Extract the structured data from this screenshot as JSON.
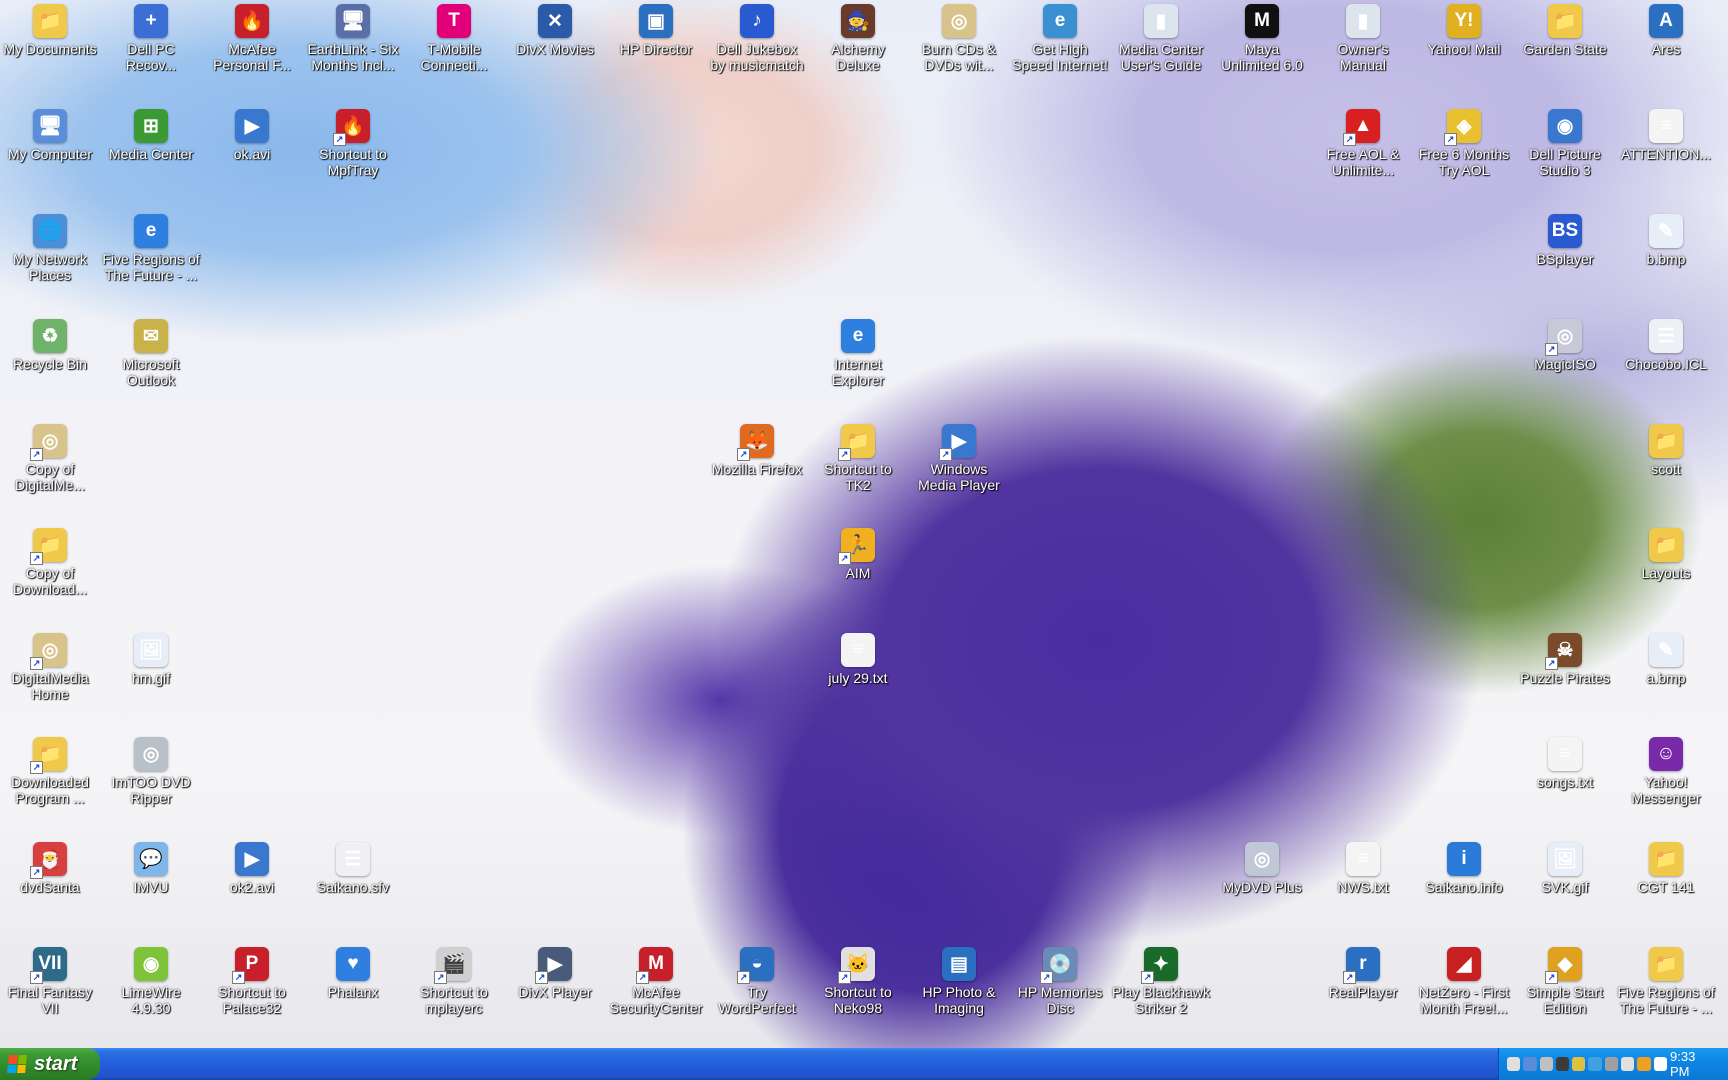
{
  "desktop": {
    "icons": [
      {
        "label": "My Documents",
        "name": "my-documents",
        "color": "#f0c94a",
        "glyph": "📁",
        "shortcut": false
      },
      {
        "label": "My Computer",
        "name": "my-computer",
        "color": "#5b8ed8",
        "glyph": "🖥",
        "shortcut": false
      },
      {
        "label": "My Network\nPlaces",
        "name": "my-network-places",
        "color": "#4a8fd9",
        "glyph": "🌐",
        "shortcut": false
      },
      {
        "label": "Recycle Bin",
        "name": "recycle-bin",
        "color": "#6fb36a",
        "glyph": "♻",
        "shortcut": false
      },
      {
        "label": "Copy of\nDigitalMe...",
        "name": "copy-of-digitalmedia",
        "color": "#d8c48a",
        "glyph": "◎",
        "shortcut": true
      },
      {
        "label": "Copy of\nDownload...",
        "name": "copy-of-downloaded",
        "color": "#f0c94a",
        "glyph": "📁",
        "shortcut": true
      },
      {
        "label": "DigitalMedia\nHome",
        "name": "digitalmedia-home",
        "color": "#d8c48a",
        "glyph": "◎",
        "shortcut": true
      },
      {
        "label": "Downloaded\nProgram ...",
        "name": "downloaded-program",
        "color": "#f0c94a",
        "glyph": "📁",
        "shortcut": true
      },
      {
        "label": "dvdSanta",
        "name": "dvdsanta",
        "color": "#d64040",
        "glyph": "🎅",
        "shortcut": true
      },
      {
        "label": "Final Fantasy\nVII",
        "name": "final-fantasy-vii",
        "color": "#2e6b8a",
        "glyph": "VII",
        "shortcut": true
      },
      {
        "label": "Dell PC\nRecov...",
        "name": "dell-pc-recovery",
        "color": "#3c6fd6",
        "glyph": "+",
        "shortcut": false
      },
      {
        "label": "Media Center",
        "name": "media-center",
        "color": "#3c9a35",
        "glyph": "⊞",
        "shortcut": false
      },
      {
        "label": "Five Regions of\nThe Future - ...",
        "name": "five-regions-ie",
        "color": "#2f7fe0",
        "glyph": "e",
        "shortcut": false
      },
      {
        "label": "Microsoft\nOutlook",
        "name": "microsoft-outlook",
        "color": "#c9b24a",
        "glyph": "✉",
        "shortcut": false
      },
      {
        "label": "hm.gif",
        "name": "hm-gif",
        "color": "#e8eef8",
        "glyph": "🖼",
        "shortcut": false
      },
      {
        "label": "ImTOO DVD\nRipper",
        "name": "imtoo-dvd-ripper",
        "color": "#b8c0c8",
        "glyph": "◎",
        "shortcut": false
      },
      {
        "label": "IMVU",
        "name": "imvu",
        "color": "#7fb6ea",
        "glyph": "💬",
        "shortcut": false
      },
      {
        "label": "LimeWire\n4.9.30",
        "name": "limewire",
        "color": "#7fc33a",
        "glyph": "◉",
        "shortcut": false
      },
      {
        "label": "McAfee\nPersonal F...",
        "name": "mcafee-personal-firewall",
        "color": "#c8202a",
        "glyph": "🔥",
        "shortcut": false
      },
      {
        "label": "ok.avi",
        "name": "ok-avi",
        "color": "#3a78d0",
        "glyph": "▶",
        "shortcut": false
      },
      {
        "label": "ok2.avi",
        "name": "ok2-avi",
        "color": "#3a78d0",
        "glyph": "▶",
        "shortcut": false
      },
      {
        "label": "Shortcut to\nPalace32",
        "name": "shortcut-palace32",
        "color": "#c8202a",
        "glyph": "P",
        "shortcut": true
      },
      {
        "label": "EarthLink - Six\nMonths Incl...",
        "name": "earthlink",
        "color": "#5a6fa8",
        "glyph": "🖥",
        "shortcut": false
      },
      {
        "label": "Shortcut to\nMpfTray",
        "name": "shortcut-mpftray",
        "color": "#c8202a",
        "glyph": "🔥",
        "shortcut": true
      },
      {
        "label": "Saikano.sfv",
        "name": "saikano-sfv",
        "color": "#eef0f6",
        "glyph": "☰",
        "shortcut": false
      },
      {
        "label": "Phalanx",
        "name": "phalanx",
        "color": "#2f7fe0",
        "glyph": "♥",
        "shortcut": false
      },
      {
        "label": "T-Mobile\nConnecti...",
        "name": "t-mobile-connection",
        "color": "#e2007a",
        "glyph": "T",
        "shortcut": false
      },
      {
        "label": "Shortcut to\nmplayerc",
        "name": "shortcut-mplayerc",
        "color": "#d0d0d0",
        "glyph": "🎬",
        "shortcut": true
      },
      {
        "label": "DivX Movies",
        "name": "divx-movies",
        "color": "#2a5aa8",
        "glyph": "✕",
        "shortcut": false
      },
      {
        "label": "DivX Player",
        "name": "divx-player",
        "color": "#4a5a7a",
        "glyph": "▶",
        "shortcut": true
      },
      {
        "label": "HP Director",
        "name": "hp-director",
        "color": "#2a6fc0",
        "glyph": "▣",
        "shortcut": false
      },
      {
        "label": "McAfee\nSecurityCenter",
        "name": "mcafee-securitycenter",
        "color": "#c8202a",
        "glyph": "M",
        "shortcut": true
      },
      {
        "label": "Dell Jukebox\nby musicmatch",
        "name": "dell-jukebox",
        "color": "#2a5ad0",
        "glyph": "♪",
        "shortcut": false
      },
      {
        "label": "Mozilla Firefox",
        "name": "mozilla-firefox",
        "color": "#e06a20",
        "glyph": "🦊",
        "shortcut": true
      },
      {
        "label": "Try\nWordPerfect",
        "name": "try-wordperfect",
        "color": "#2a6fc0",
        "glyph": "◒",
        "shortcut": true
      },
      {
        "label": "Alchemy\nDeluxe",
        "name": "alchemy-deluxe",
        "color": "#6a3a2a",
        "glyph": "🧙",
        "shortcut": false
      },
      {
        "label": "Internet\nExplorer",
        "name": "internet-explorer",
        "color": "#2f7fe0",
        "glyph": "e",
        "shortcut": false
      },
      {
        "label": "Shortcut to\nTK2",
        "name": "shortcut-tk2",
        "color": "#f0c94a",
        "glyph": "📁",
        "shortcut": true
      },
      {
        "label": "AIM",
        "name": "aim",
        "color": "#f0b020",
        "glyph": "🏃",
        "shortcut": true
      },
      {
        "label": "july 29.txt",
        "name": "july-29-txt",
        "color": "#f4f4f4",
        "glyph": "≡",
        "shortcut": false
      },
      {
        "label": "Shortcut to\nNeko98",
        "name": "shortcut-neko98",
        "color": "#e0e0e0",
        "glyph": "🐱",
        "shortcut": true
      },
      {
        "label": "Burn CDs &\nDVDs wit...",
        "name": "burn-cds-dvds",
        "color": "#d8c48a",
        "glyph": "◎",
        "shortcut": false
      },
      {
        "label": "Windows\nMedia Player",
        "name": "windows-media-player",
        "color": "#3a78d0",
        "glyph": "▶",
        "shortcut": true
      },
      {
        "label": "HP Photo &\nImaging",
        "name": "hp-photo-imaging",
        "color": "#2a6fc0",
        "glyph": "▤",
        "shortcut": false
      },
      {
        "label": "Get High\nSpeed Internet!",
        "name": "get-high-speed-internet",
        "color": "#3a90d0",
        "glyph": "e",
        "shortcut": false
      },
      {
        "label": "HP Memories\nDisc",
        "name": "hp-memories-disc",
        "color": "#6a8ab8",
        "glyph": "💿",
        "shortcut": true
      },
      {
        "label": "Media Center\nUser's Guide",
        "name": "media-center-users-guide",
        "color": "#dce4ee",
        "glyph": "▮",
        "shortcut": false
      },
      {
        "label": "Play Blackhawk\nStriker 2",
        "name": "play-blackhawk-striker-2",
        "color": "#1a6a2a",
        "glyph": "✦",
        "shortcut": true
      },
      {
        "label": "Maya\nUnlimited 6.0",
        "name": "maya-unlimited",
        "color": "#101010",
        "glyph": "M",
        "shortcut": false
      },
      {
        "label": "MyDVD Plus",
        "name": "mydvd-plus",
        "color": "#c0c8d8",
        "glyph": "◎",
        "shortcut": false
      },
      {
        "label": "Owner's\nManual",
        "name": "owners-manual",
        "color": "#dce4ee",
        "glyph": "▮",
        "shortcut": false
      },
      {
        "label": "Free AOL &\nUnlimite...",
        "name": "free-aol-unlimited",
        "color": "#d82020",
        "glyph": "▲",
        "shortcut": true
      },
      {
        "label": "NWS.txt",
        "name": "nws-txt",
        "color": "#f4f4f4",
        "glyph": "≡",
        "shortcut": false
      },
      {
        "label": "RealPlayer",
        "name": "realplayer",
        "color": "#2a6fc0",
        "glyph": "r",
        "shortcut": true
      },
      {
        "label": "Yahoo! Mail",
        "name": "yahoo-mail",
        "color": "#e0b020",
        "glyph": "Y!",
        "shortcut": false
      },
      {
        "label": "Free 6 Months\nTry AOL",
        "name": "free-6-months-try-aol",
        "color": "#e8c030",
        "glyph": "◈",
        "shortcut": true
      },
      {
        "label": "Saikano.info",
        "name": "saikano-info",
        "color": "#2a7ad8",
        "glyph": "i",
        "shortcut": false
      },
      {
        "label": "NetZero - First\nMonth Free!...",
        "name": "netzero",
        "color": "#c82020",
        "glyph": "◢",
        "shortcut": false
      },
      {
        "label": "Garden State",
        "name": "garden-state",
        "color": "#f0c94a",
        "glyph": "📁",
        "shortcut": false
      },
      {
        "label": "Dell Picture\nStudio 3",
        "name": "dell-picture-studio",
        "color": "#3a78d0",
        "glyph": "◉",
        "shortcut": false
      },
      {
        "label": "BSplayer",
        "name": "bsplayer",
        "color": "#2a5ad0",
        "glyph": "BS",
        "shortcut": false
      },
      {
        "label": "MagicISO",
        "name": "magiciso",
        "color": "#c8c8d8",
        "glyph": "◎",
        "shortcut": true
      },
      {
        "label": "Puzzle Pirates",
        "name": "puzzle-pirates",
        "color": "#7a4a2a",
        "glyph": "☠",
        "shortcut": true
      },
      {
        "label": "songs.txt",
        "name": "songs-txt",
        "color": "#f4f4f4",
        "glyph": "≡",
        "shortcut": false
      },
      {
        "label": "SVK.gif",
        "name": "svk-gif",
        "color": "#e8eef8",
        "glyph": "🖼",
        "shortcut": false
      },
      {
        "label": "Simple Start\nEdition",
        "name": "simple-start-edition",
        "color": "#e0a020",
        "glyph": "◆",
        "shortcut": true
      },
      {
        "label": "Ares",
        "name": "ares",
        "color": "#2a6fc0",
        "glyph": "A",
        "shortcut": false
      },
      {
        "label": "ATTENTION...",
        "name": "attention-txt",
        "color": "#f4f4f4",
        "glyph": "≡",
        "shortcut": false
      },
      {
        "label": "b.bmp",
        "name": "b-bmp",
        "color": "#e8eef8",
        "glyph": "✎",
        "shortcut": false
      },
      {
        "label": "Chocobo.ICL",
        "name": "chocobo-icl",
        "color": "#eef0f6",
        "glyph": "☰",
        "shortcut": false
      },
      {
        "label": "scott",
        "name": "scott-folder",
        "color": "#f0c94a",
        "glyph": "📁",
        "shortcut": false
      },
      {
        "label": "Layouts",
        "name": "layouts-folder",
        "color": "#f0c94a",
        "glyph": "📁",
        "shortcut": false
      },
      {
        "label": "a.bmp",
        "name": "a-bmp",
        "color": "#e8eef8",
        "glyph": "✎",
        "shortcut": false
      },
      {
        "label": "Yahoo!\nMessenger",
        "name": "yahoo-messenger",
        "color": "#7a2aa8",
        "glyph": "☺",
        "shortcut": false
      },
      {
        "label": "CGT 141",
        "name": "cgt-141-folder",
        "color": "#f0c94a",
        "glyph": "📁",
        "shortcut": false
      },
      {
        "label": "Five Regions of\nThe Future - ...",
        "name": "five-regions-folder",
        "color": "#f0c94a",
        "glyph": "📁",
        "shortcut": false
      }
    ]
  },
  "taskbar": {
    "start_label": "start",
    "clock": "9:33 PM",
    "tray_colors": [
      "#e0e0e0",
      "#5a8ad8",
      "#c0c0c0",
      "#3a3a3a",
      "#e0c040",
      "#40a0e0",
      "#a0a0a0",
      "#e0e0e0",
      "#f0a020",
      "#ffffff"
    ]
  }
}
